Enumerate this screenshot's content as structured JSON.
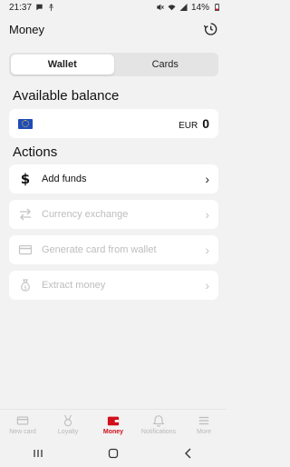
{
  "status": {
    "time": "21:37",
    "battery": "14%"
  },
  "header": {
    "title": "Money"
  },
  "tabs": [
    {
      "label": "Wallet"
    },
    {
      "label": "Cards"
    }
  ],
  "balance": {
    "section_title": "Available balance",
    "currency": "EUR",
    "amount": "0"
  },
  "actions": {
    "section_title": "Actions",
    "items": [
      {
        "label": "Add funds",
        "icon": "dollar-icon"
      },
      {
        "label": "Currency exchange",
        "icon": "exchange-icon"
      },
      {
        "label": "Generate card from wallet",
        "icon": "card-icon"
      },
      {
        "label": "Extract money",
        "icon": "money-bag-icon"
      }
    ]
  },
  "bottom_nav": [
    {
      "label": "New card",
      "icon": "card-icon"
    },
    {
      "label": "Loyalty",
      "icon": "medal-icon"
    },
    {
      "label": "Money",
      "icon": "wallet-icon"
    },
    {
      "label": "Notifications",
      "icon": "bell-icon"
    },
    {
      "label": "More",
      "icon": "menu-icon"
    }
  ],
  "colors": {
    "accent": "#d0101b",
    "background": "#f2f2f2",
    "card": "#ffffff",
    "disabled_text": "#bdbdbd"
  }
}
